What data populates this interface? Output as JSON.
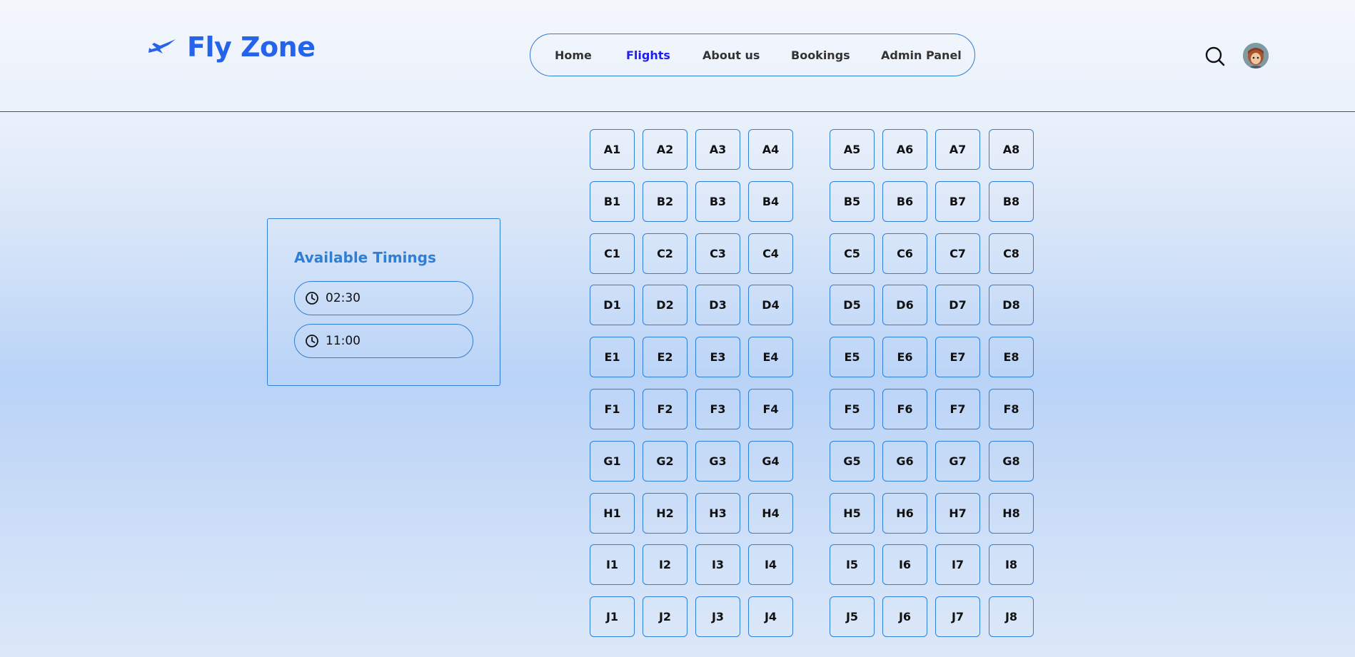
{
  "brand": {
    "name": "Fly Zone",
    "icon": "plane-icon",
    "color": "#2563eb"
  },
  "nav": {
    "items": [
      {
        "label": "Home",
        "active": false
      },
      {
        "label": "Flights",
        "active": true
      },
      {
        "label": "About us",
        "active": false
      },
      {
        "label": "Bookings",
        "active": false
      },
      {
        "label": "Admin Panel",
        "active": false
      }
    ]
  },
  "header_actions": {
    "search_icon": "search-icon",
    "avatar": "user-avatar"
  },
  "timings": {
    "title": "Available Timings",
    "slots": [
      {
        "time": "02:30",
        "icon": "clock-icon"
      },
      {
        "time": "11:00",
        "icon": "clock-icon"
      }
    ]
  },
  "seats": {
    "rows": [
      "A",
      "B",
      "C",
      "D",
      "E",
      "F",
      "G",
      "H",
      "I",
      "J"
    ],
    "left_columns": [
      "1",
      "2",
      "3",
      "4"
    ],
    "right_columns": [
      "5",
      "6",
      "7",
      "8"
    ]
  },
  "colors": {
    "accent": "#2f7fd6",
    "active_nav": "#1d1ef0"
  }
}
